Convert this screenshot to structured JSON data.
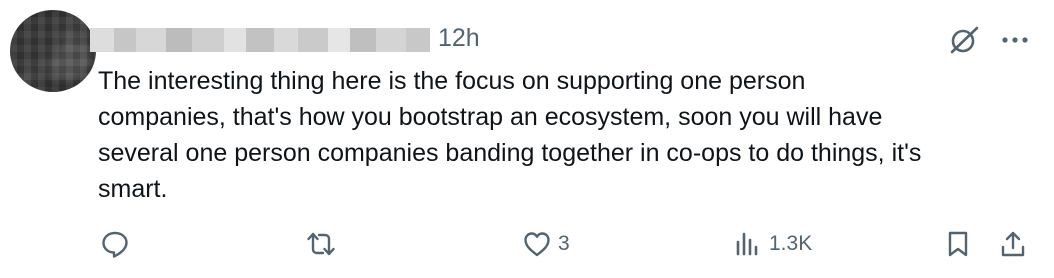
{
  "post": {
    "author_name_redacted": "",
    "timestamp": "12h",
    "text_lines": [
      "The interesting thing here is the focus on supporting one person",
      "companies, that's how you bootstrap an ecosystem, soon you will have",
      "several one person companies banding together in co-ops to do things, it's",
      "smart."
    ]
  },
  "actions": {
    "replies": "",
    "reposts": "",
    "likes": "3",
    "views": "1.3K"
  },
  "icons": {
    "reply": "reply-icon",
    "repost": "repost-icon",
    "like": "heart-icon",
    "views": "views-icon",
    "bookmark": "bookmark-icon",
    "share": "share-icon",
    "grok": "grok-icon",
    "more": "more-icon"
  },
  "colors": {
    "text_primary": "#0f1419",
    "text_secondary": "#536471"
  }
}
